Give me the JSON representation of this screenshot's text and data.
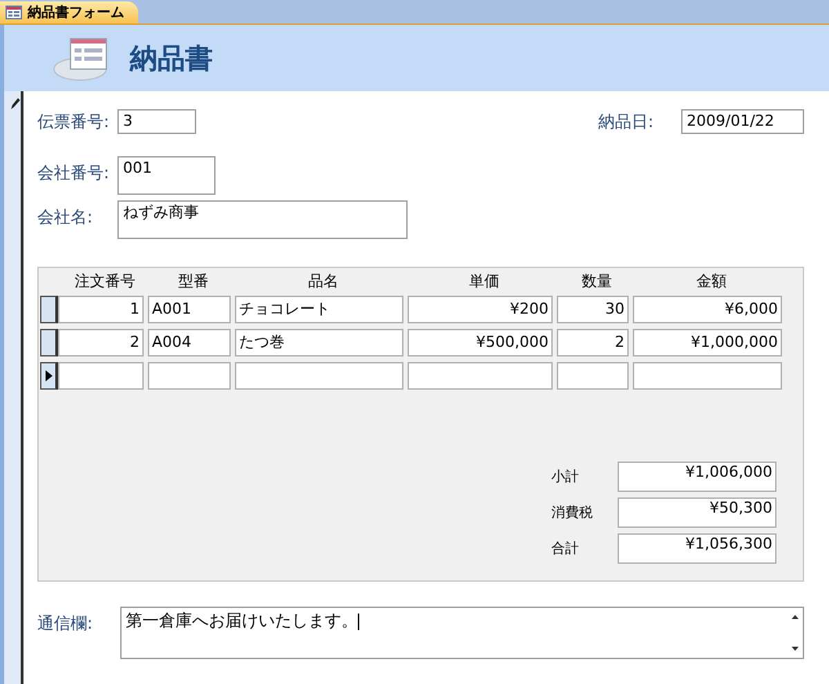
{
  "tab": {
    "label": "納品書フォーム",
    "selected": true
  },
  "header": {
    "title": "納品書"
  },
  "fields": {
    "slip_no": {
      "label": "伝票番号:",
      "value": "3"
    },
    "delivery_date": {
      "label": "納品日:",
      "value": "2009/01/22"
    },
    "company_no": {
      "label": "会社番号:",
      "value": "001"
    },
    "company_name": {
      "label": "会社名:",
      "value": "ねずみ商事"
    }
  },
  "table": {
    "columns": [
      "注文番号",
      "型番",
      "品名",
      "単価",
      "数量",
      "金額"
    ],
    "rows": [
      {
        "current": false,
        "cells": [
          "1",
          "A001",
          "チョコレート",
          "¥200",
          "30",
          "¥6,000"
        ]
      },
      {
        "current": false,
        "cells": [
          "2",
          "A004",
          "たつ巻",
          "¥500,000",
          "2",
          "¥1,000,000"
        ]
      },
      {
        "current": true,
        "cells": [
          "",
          "",
          "",
          "",
          "",
          ""
        ]
      }
    ]
  },
  "totals": [
    {
      "label": "小計",
      "value": "¥1,006,000"
    },
    {
      "label": "消費税",
      "value": "¥50,300"
    },
    {
      "label": "合計",
      "value": "¥1,056,300"
    }
  ],
  "memo": {
    "label": "通信欄:",
    "value": "第一倉庫へお届けいたします。"
  }
}
